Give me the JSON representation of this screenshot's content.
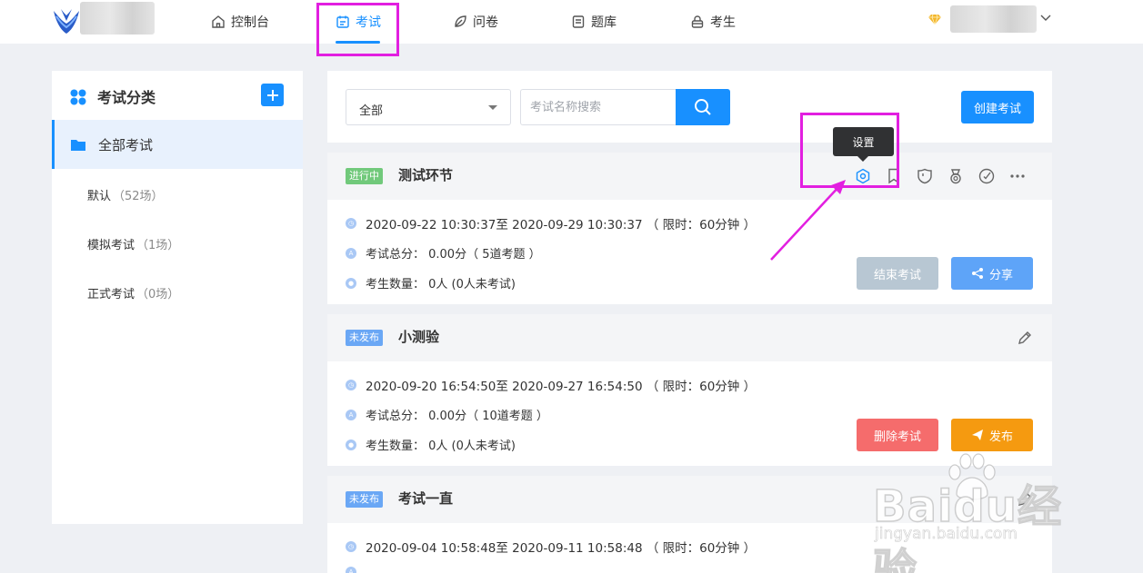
{
  "nav": {
    "items": [
      {
        "label": "控制台",
        "icon": "home-icon"
      },
      {
        "label": "考试",
        "icon": "calendar-icon"
      },
      {
        "label": "问卷",
        "icon": "leaf-icon"
      },
      {
        "label": "题库",
        "icon": "book-icon"
      },
      {
        "label": "考生",
        "icon": "lock-user-icon"
      }
    ],
    "active_index": 1,
    "brand_color": "#1890ff",
    "highlight_color": "#e21fe0"
  },
  "sidebar": {
    "title": "考试分类",
    "active_label": "全部考试",
    "items": [
      {
        "label": "默认",
        "count": "（52场）"
      },
      {
        "label": "模拟考试",
        "count": "（1场）"
      },
      {
        "label": "正式考试",
        "count": "（0场）"
      }
    ]
  },
  "toolbar": {
    "select_value": "全部",
    "search_placeholder": "考试名称搜索",
    "create_label": "创建考试"
  },
  "tooltip": "设置",
  "exams": [
    {
      "status": "进行中",
      "title": "测试环节",
      "date": "2020-09-22 10:30:37至 2020-09-29 10:30:37 （ 限时：60分钟 ）",
      "score": "考试总分： 0.00分（ 5道考题 ）",
      "students": "考生数量： 0人 (0人未考试)",
      "btn1": "结束考试",
      "btn2": "分享"
    },
    {
      "status": "未发布",
      "title": "小测验",
      "date": "2020-09-20 16:54:50至 2020-09-27 16:54:50 （ 限时：60分钟 ）",
      "score": "考试总分： 0.00分（ 10道考题 ）",
      "students": "考生数量： 0人 (0人未考试)",
      "btn1": "删除考试",
      "btn2": "发布"
    },
    {
      "status": "未发布",
      "title": "考试一直",
      "date": "2020-09-04 10:58:48至 2020-09-11 10:58:48 （ 限时：60分钟 ）"
    }
  ],
  "watermark": {
    "main": "Baidu经验",
    "sub": "jingyan.baidu.com"
  }
}
